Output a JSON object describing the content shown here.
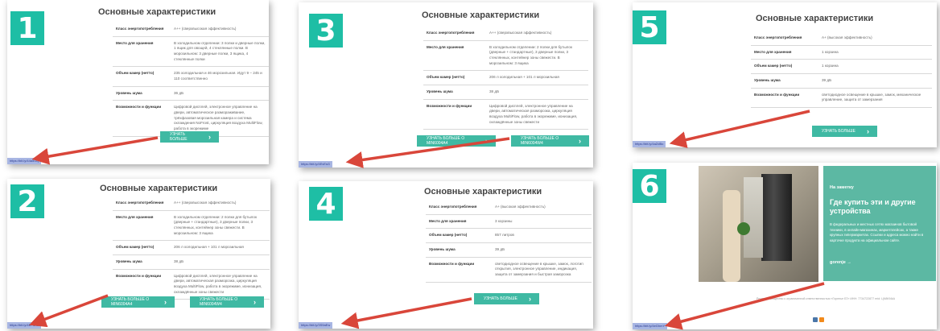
{
  "colors": {
    "teal": "#1ebea5",
    "button": "#3fb9a3",
    "arrow": "#d9463a",
    "url_bg": "#a8b6e3"
  },
  "numbers": [
    "1",
    "2",
    "3",
    "4",
    "5",
    "6"
  ],
  "icons": {
    "button_chevron": "chevron-right-icon",
    "arrow": "red-pointer-arrow"
  },
  "title": "Основные характеристики",
  "cards": {
    "c1": {
      "rows": [
        {
          "k": "Класс энергопотребления",
          "v": "А++ (сверхвысокая эффективность)"
        },
        {
          "k": "Место для хранения",
          "v": "В холодильном отделении: 3 полки и дверные полки, 1 ящик для овощей, 4 стеклянные полки. В морозильном: 3 дверные полки, 3 ящика, 4 стеклянные полки"
        },
        {
          "k": "Объем камер (нетто)",
          "v": "235 холодильная и 46 морозильная. Идут 9 – 245 и 110 соответственно"
        },
        {
          "k": "Уровень шума",
          "v": "36 дБ"
        },
        {
          "k": "Возможности и функции",
          "v": "Цифровой дисплей, электронное управление на двери, автоматическое размораживание, трёхфазовая морозильная камера и система охлаждения NoFrost, циркуляция воздуха MultiFlow, работа в экорежиме"
        }
      ],
      "button": "УЗНАТЬ БОЛЬШЕ",
      "url": "https://bit.ly/44a5Gq"
    },
    "c2": {
      "rows": [
        {
          "k": "Класс энергопотребления",
          "v": "А++ (сверхвысокая эффективность)"
        },
        {
          "k": "Место для хранения",
          "v": "В холодильном отделении: 2 полки для бутылок (дверные + стандартные), 3 дверные полки, 3 стеклянных, контейнер зоны свежести. В морозильном: 3 ящика"
        },
        {
          "k": "Объем камер (нетто)",
          "v": "206 л холодильная + 101 л морозильная"
        },
        {
          "k": "Уровень шума",
          "v": "38 дБ"
        },
        {
          "k": "Возможности и функции",
          "v": "Цифровой дисплей, электронное управление на двери, автоматическая разморозка, циркуляция воздуха MultiFlow, работа в экорежиме, ионизация, охлаждённые зоны свежести"
        }
      ],
      "button1": "УЗНАТЬ БОЛЬШЕ О MIN6004A4",
      "button2": "УЗНАТЬ БОЛЬШЕ О MIN6004W4",
      "url": "https://bit.ly/4EFdAw"
    },
    "c3": {
      "rows": [
        {
          "k": "Класс энергопотребления",
          "v": "А++ (сверхвысокая эффективность)"
        },
        {
          "k": "Место для хранения",
          "v": "В холодильном отделении: 2 полки для бутылок (дверные + стандартные), 3 дверные полки, 3 стеклянных, контейнер зоны свежести. В морозильном: 3 ящика"
        },
        {
          "k": "Объем камер (нетто)",
          "v": "206 л холодильная + 101 л морозильная"
        },
        {
          "k": "Уровень шума",
          "v": "38 дБ"
        },
        {
          "k": "Возможности и функции",
          "v": "Цифровой дисплей, электронное управление на двери, автоматическая разморозка, циркуляция воздуха MultiFlow, работа в экорежиме, ионизация, охлаждённые зоны свежести"
        }
      ],
      "button1": "УЗНАТЬ БОЛЬШЕ О MIN6004A4",
      "button2": "УЗНАТЬ БОЛЬШЕ О MIN6004W4",
      "url": "https://bit.ly/4EvEsG"
    },
    "c4": {
      "rows": [
        {
          "k": "Класс энергопотребления",
          "v": "А+ (высокая эффективность)"
        },
        {
          "k": "Место для хранения",
          "v": "3 корзины"
        },
        {
          "k": "Объем камер (нетто)",
          "v": "857 литров"
        },
        {
          "k": "Уровень шума",
          "v": "39 дБ"
        },
        {
          "k": "Возможности и функции",
          "v": "светодиодное освещение в крышке, замок, логотип открытия, электронное управление, индикация, защита от замерзания и быстрая заморозка"
        }
      ],
      "button": "УЗНАТЬ БОЛЬШЕ",
      "url": "https://bit.ly/3S9aEw"
    },
    "c5": {
      "rows": [
        {
          "k": "Класс энергопотребления",
          "v": "А+ (высокая эффективность)"
        },
        {
          "k": "Место для хранения",
          "v": "1 корзина"
        },
        {
          "k": "Объем камер (нетто)",
          "v": "1 корзина"
        },
        {
          "k": "Уровень шума",
          "v": "39 дБ"
        },
        {
          "k": "Возможности и функции",
          "v": "светодиодное освещение в крышке, замок, механическое управление, защита от замерзания"
        }
      ],
      "button": "УЗНАТЬ БОЛЬШЕ",
      "url": "https://bit.ly/4aZdBo"
    },
    "c6": {
      "note_small": "На заметку",
      "note_title": "Где купить эти и другие устройства",
      "note_body": "В федеральных и местных сетях магазинов бытовой техники, в онлайн-магазинах, маркетплейсах, а также крупных гипермаркетах. Ссылки и адреса можно найти в карточке продукта на официальном сайте.",
      "note_link": "gorenje →",
      "footer": "Реклама. Общество с ограниченной ответственностью «Горенье БТ» ИНН: 7734722877 erid: LjN8Kf4kA",
      "url": "https://bit.ly/4eGhmY"
    }
  }
}
